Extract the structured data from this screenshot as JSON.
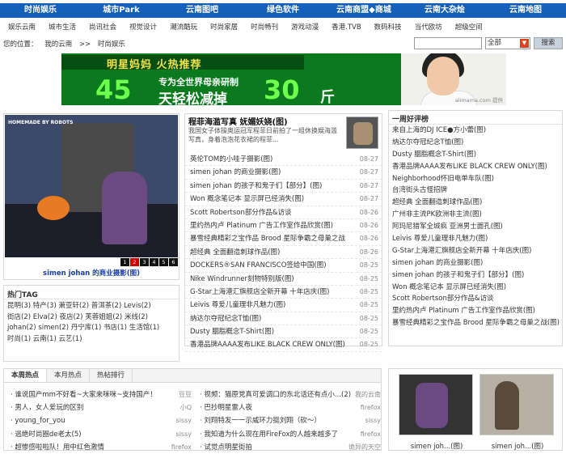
{
  "topnav": [
    "时尚娱乐",
    "城市Park",
    "云南图吧",
    "绿色软件",
    "云南商盟◆商城",
    "云南大杂烩",
    "云南地图"
  ],
  "subnav": [
    "娱乐云南",
    "城市生活",
    "尚讯社会",
    "视觉设计",
    "潮流酷玩",
    "时尚家居",
    "时尚畅刊",
    "游戏动漫",
    "香港.TVB",
    "数码科技",
    "当代欧坊",
    "超级空间"
  ],
  "location": {
    "label": "您的位置：",
    "path": [
      "我的云南",
      ">>",
      "时尚娱乐"
    ]
  },
  "search": {
    "placeholder": "",
    "select": "全部",
    "button": "搜索"
  },
  "banner": {
    "line1": "明星妈妈 火热推荐",
    "num1": "45",
    "line2": "专为全世界母亲研制",
    "line3": "天轻松减掉",
    "num2": "30",
    "unit": "斤",
    "watermark": "alimama.com 提供"
  },
  "photo": {
    "logo": "HOMEMADE BY ROBOTS",
    "pages": [
      "1",
      "2",
      "3",
      "4",
      "5",
      "6"
    ],
    "caption": "simen johan 的商业摄影(图)"
  },
  "tags": {
    "title": "热门TAG",
    "rows": [
      "昆明(3) 特产(3) 萧亚轩(2) 普洱茶(2) Levis(2)",
      "街店(2) Elva(2) 夜店(2) 芙蓉姐姐(2) 米线(2)",
      "johan(2) simen(2) 丹宁库(1) 书店(1) 生活馆(1)",
      "时尚(1) 云南(1) 云艺(1)"
    ]
  },
  "news": {
    "headline": "程菲海滥写真 妩媚妖娆(图)",
    "desc": "我国女子体操奥运冠军程菲日前拍了一组休换娱海滥写真，身着泡泡花衣裙的程菲...",
    "items": [
      {
        "t": "英伦TOM的小哇子摄影(图)",
        "d": "08-27"
      },
      {
        "t": "simen johan 的商业摄影(图)",
        "d": "08-27"
      },
      {
        "t": "simen johan 的孩子和鬼子们【部分】(图)",
        "d": "08-27"
      },
      {
        "t": "Won 概念笔记本 显示屏已经消失(图)",
        "d": "08-27"
      },
      {
        "t": "Scott Robertson部分作品&访谈",
        "d": "08-26"
      },
      {
        "t": "里约热内卢 Platinum 广告工作室作品欣赏(图)",
        "d": "08-26"
      },
      {
        "t": "暴雪经典精彩之宝作品 Brood 星际争霸之母巢之战",
        "d": "08-26"
      },
      {
        "t": "超经典 全面翻造刺球作品(图)",
        "d": "08-26"
      },
      {
        "t": "DOCKERS®SAN FRANCISCO签给中国(图)",
        "d": "08-25"
      },
      {
        "t": "Nike Windrunner刻物特别版(图)",
        "d": "08-25"
      },
      {
        "t": "G-Star上海港汇旗舰店全新开幕 十年店庆(图)",
        "d": "08-25"
      },
      {
        "t": "Leivis 尊爱儿童理非凡魅力(图)",
        "d": "08-25"
      },
      {
        "t": "纳达尔夺冠纪念T恤(图)",
        "d": "08-25"
      },
      {
        "t": "Dusty 胭脂概念T-Shirt(图)",
        "d": "08-25"
      },
      {
        "t": "香港品牌AAAA发布LIKE BLACK CREW ONLY(图)",
        "d": "08-25"
      }
    ]
  },
  "week": {
    "title": "一周好评榜",
    "items": [
      "来自上海的DJ ICE●方小蕾(图)",
      "纳达尔夺冠纪念T恤(图)",
      "Dusty 胭脂概念T-Shirt(图)",
      "香港品牌AAAA发布LIKE BLACK CREW ONLY(图)",
      "Neighborhood怀旧电单车队(图)",
      "台湾街头古怪招牌",
      "超经典 全面翻造刺球作品(图)",
      "广州非主流PK欧洲非主流(图)",
      "阿玛尼猎军全城疯 亚洲男士面孔(图)",
      "Leivis 尊爱儿童理非凡魅力(图)",
      "G-Star上海港汇旗舰店全新开幕 十年店庆(图)",
      "simen johan 的商业摄影(图)",
      "simen johan 的孩子和鬼子们【部分】(图)",
      "Won 概念笔记本 显示屏已经消失(图)",
      "Scott Robertson部分作品&访谈",
      "里约热内卢 Platinum 广告工作室作品欣赏(图)",
      "暴雪经典精彩之宝作品 Brood 星际争霸之母巢之战(图)"
    ]
  },
  "hot": {
    "tabs": [
      "本周热点",
      "本月热点",
      "热帖排行"
    ],
    "left": [
      {
        "t": "谁说国产mm不好看~大家来咪咪~支持国产！",
        "a": "豆豆"
      },
      {
        "t": "男人，女人爱玩的区别",
        "a": "小Q"
      },
      {
        "t": "young_for_you",
        "a": "sissy"
      },
      {
        "t": "逃绝时尚圈de老太(5)",
        "a": "sissy"
      },
      {
        "t": "超惨感啦啦队！用中红色激情",
        "a": "firefox"
      }
    ],
    "right": [
      {
        "t": "视频：猫原党真可爱调口的东北话还有点小...(2)",
        "a": "我的云南"
      },
      {
        "t": "巴抄明星雷人夜",
        "a": "firefox"
      },
      {
        "t": "刘翔特发一一示威环力挺刘翔（砍～）",
        "a": "sissy"
      },
      {
        "t": "我知道为什么现在用FireFox的人越来越多了",
        "a": "firefox"
      },
      {
        "t": "试觉点明星街拍",
        "a": "诡异的天空"
      }
    ]
  },
  "thumbs": [
    "simen joh...(图)",
    "simen joh...(图)"
  ]
}
